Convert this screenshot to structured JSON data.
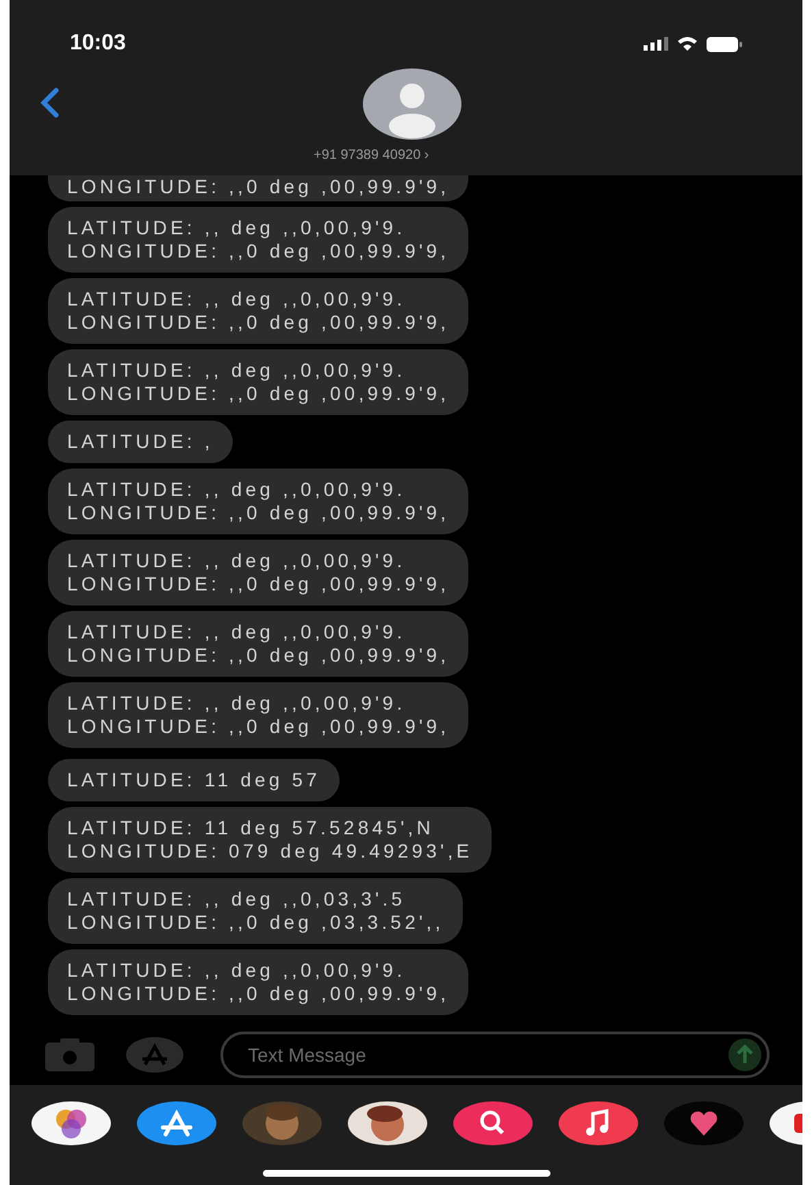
{
  "status_bar": {
    "time": "10:03"
  },
  "header": {
    "contact": "+91 97389 40920 ›"
  },
  "messages": [
    {
      "lines": [
        "LONGITUDE: ,,0 deg ,00,99.9'9,"
      ],
      "cut": true
    },
    {
      "lines": [
        "LATITUDE: ,, deg ,,0,00,9'9.",
        "LONGITUDE: ,,0 deg ,00,99.9'9,"
      ]
    },
    {
      "lines": [
        "LATITUDE: ,, deg ,,0,00,9'9.",
        "LONGITUDE: ,,0 deg ,00,99.9'9,"
      ]
    },
    {
      "lines": [
        "LATITUDE: ,, deg ,,0,00,9'9.",
        "LONGITUDE: ,,0 deg ,00,99.9'9,"
      ]
    },
    {
      "lines": [
        "LATITUDE: ,"
      ]
    },
    {
      "lines": [
        "LATITUDE: ,, deg ,,0,00,9'9.",
        "LONGITUDE: ,,0 deg ,00,99.9'9,"
      ]
    },
    {
      "lines": [
        "LATITUDE: ,, deg ,,0,00,9'9.",
        "LONGITUDE: ,,0 deg ,00,99.9'9,"
      ]
    },
    {
      "lines": [
        "LATITUDE: ,, deg ,,0,00,9'9.",
        "LONGITUDE: ,,0 deg ,00,99.9'9,"
      ]
    },
    {
      "lines": [
        "LATITUDE: ,, deg ,,0,00,9'9.",
        "LONGITUDE: ,,0 deg ,00,99.9'9,"
      ]
    },
    {
      "lines": [
        "LATITUDE: 11 deg 57"
      ]
    },
    {
      "lines": [
        "LATITUDE: 11 deg 57.52845',N",
        "LONGITUDE: 079 deg 49.49293',E"
      ]
    },
    {
      "lines": [
        "LATITUDE: ,, deg ,,0,03,3'.5",
        "LONGITUDE: ,,0 deg ,03,3.52',,"
      ]
    },
    {
      "lines": [
        "LATITUDE: ,, deg ,,0,00,9'9.",
        "LONGITUDE: ,,0 deg ,00,99.9'9,"
      ]
    }
  ],
  "composer": {
    "placeholder": "Text Message"
  }
}
